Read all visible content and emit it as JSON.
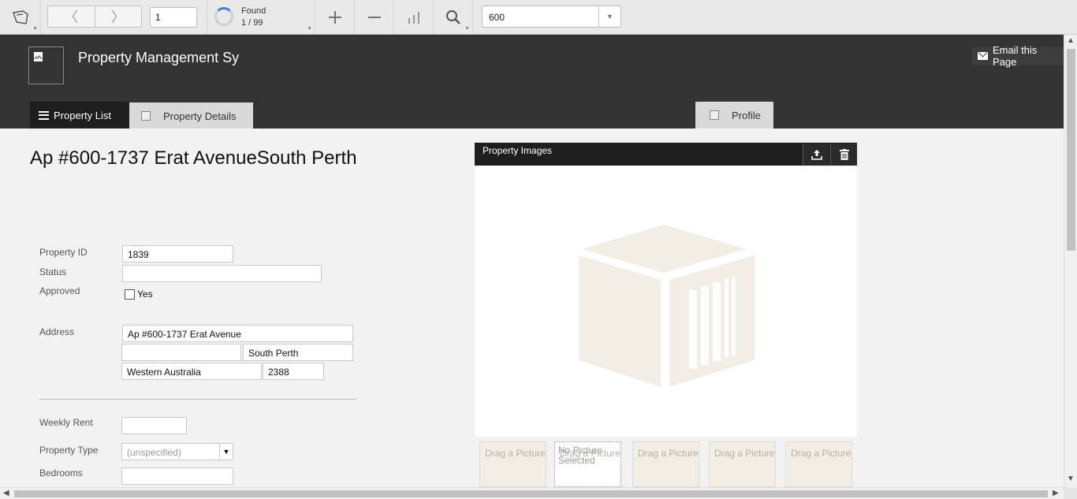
{
  "toolbar": {
    "record_number": "1",
    "found_label": "Found",
    "found_count": "1 / 99",
    "zoom_select_value": "600",
    "icons": [
      "layout-icon",
      "previous-icon",
      "next-icon",
      "add-record-icon",
      "delete-record-icon",
      "chart-icon",
      "search-icon",
      "dropdown-icon"
    ]
  },
  "header": {
    "app_title": "Property Management Sy",
    "email_button": "Email this Page",
    "tabs": [
      {
        "label": "Property List"
      },
      {
        "label": "Property Details"
      },
      {
        "label": "Profile"
      }
    ]
  },
  "record": {
    "title": "Ap #600-1737 Erat AvenueSouth Perth",
    "fields": {
      "property_id_label": "Property ID",
      "property_id_value": "1839",
      "status_label": "Status",
      "status_value": "",
      "approved_label": "Approved",
      "approved_option": "Yes",
      "address_label": "Address",
      "address_line1": "Ap #600-1737 Erat Avenue",
      "address_line2": "",
      "city": "South Perth",
      "state": "Western Australia",
      "postcode": "2388",
      "weekly_rent_label": "Weekly Rent",
      "weekly_rent_value": "",
      "property_type_label": "Property Type",
      "property_type_value": "(unspecified)",
      "bedrooms_label": "Bedrooms",
      "bedrooms_value": ""
    }
  },
  "images": {
    "title": "Property Images",
    "thumbnails": [
      {
        "text": "Drag a Picture"
      },
      {
        "text": "Drag a Picture",
        "overlay": "No Picture Selected"
      },
      {
        "text": "Drag a Picture"
      },
      {
        "text": "Drag a Picture"
      },
      {
        "text": "Drag a Picture"
      }
    ]
  },
  "colors": {
    "header_bg": "#333333",
    "active_tab_bg": "#1e1e1e",
    "placeholder_box": "#f2eee6"
  }
}
